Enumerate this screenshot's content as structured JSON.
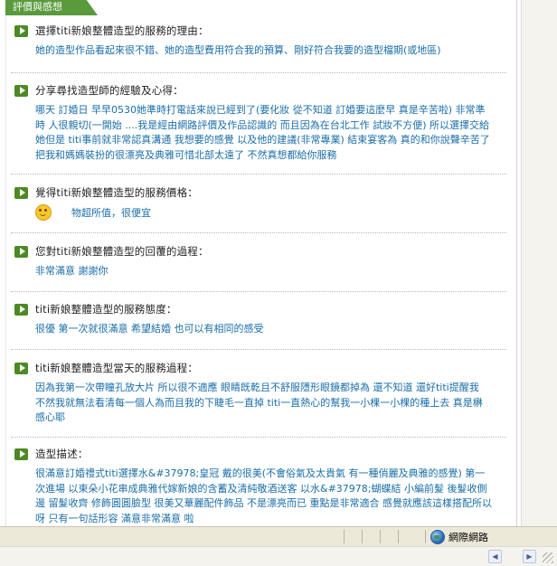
{
  "header": {
    "tab_label": "評價與感想"
  },
  "questions": [
    {
      "title": "選擇titi新娘整體造型的服務的理由：",
      "answer": "她的造型作品看起來很不錯、她的造型費用符合我的預算、剛好符合我要的造型檔期(或地區)"
    },
    {
      "title": "分享尋找造型師的經驗及心得：",
      "answer": "哪天 訂婚日 早早0530她準時打電話來說已經到了(要化妝 從不知道 訂婚要這麼早 真是辛苦啦) 非常準時 人很親切(一開始 ....我是經由網路評價及作品認識的 而且因為在台北工作 試妝不方便) 所以選擇交給她但是 titi事前就非常認真溝通 我想要的感覺 以及他的建議(非常專業) 結束宴客為 真的和你說聲辛苦了 把我和媽媽裝扮的很漂亮及典雅可惜北部太遠了 不然真想都給你服務"
    },
    {
      "title": "覺得titi新娘整體造型的服務價格：",
      "answer": "物超所值，很便宜"
    },
    {
      "title": "您對titi新娘整體造型的回覆的過程：",
      "answer": "非常滿意 謝謝你"
    },
    {
      "title": "titi新娘整體造型的服務態度：",
      "answer": "很優 第一次就很滿意 希望結婚 也可以有相同的感受"
    },
    {
      "title": "titi新娘整體造型當天的服務過程：",
      "answer": "因為我第一次帶瞳孔放大片 所以很不適應 眼睛既乾且不舒服隱形眼鏡都掉為 還不知道 還好titi提醒我 不然我就無法看清每一個人為而且我的下睫毛一直掉 titi一直熱心的幫我一小棵一小棵的種上去 真是楙感心耶"
    },
    {
      "title": "造型描述：",
      "answer": "很滿意訂婚禮式titi選擇水&#37978;皇冠 戴的很美(不會俗氣及太貴氣 有一種俏麗及典雅的感覺) 第一次進場 以束朵小花串成典雅代嫁新娘的含蓄及清純敬酒送客 以水&#37978;蝴蝶結 小編前髮 後髮收側邊 留髮收齊 修飾圓圓臉型 很美又華麗配件飾品 不是漂亮而已 重點是非常適合 感覺就應該這樣搭配所以呀 只有一句話形容 滿意非常滿意 啦"
    }
  ],
  "statusbar": {
    "zone_label": "網際網路"
  },
  "colors": {
    "accent": "#4c8a24",
    "answer_text": "#1a6ea8",
    "tab_bg": "#5a9a3c"
  },
  "icons": {
    "bullet": "play-arrow-icon",
    "price": "smiley-face-icon",
    "zone": "globe-icon"
  }
}
